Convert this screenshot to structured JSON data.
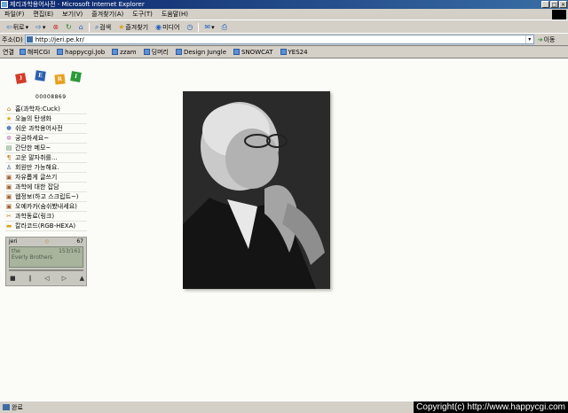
{
  "window": {
    "title": "제리과학용어사전 - Microsoft Internet Explorer"
  },
  "menu": {
    "items": [
      "파일(F)",
      "편집(E)",
      "보기(V)",
      "즐겨찾기(A)",
      "도구(T)",
      "도움말(H)"
    ]
  },
  "toolbar": {
    "back": "뒤로",
    "search": "검색",
    "favorites": "즐겨찾기",
    "media": "미디어"
  },
  "address": {
    "label": "주소(D)",
    "url": "http://jeri.pe.kr/",
    "go": "이동"
  },
  "links": {
    "label": "연결",
    "items": [
      "해피CGI",
      "happycgi.Job",
      "zzam",
      "딩머리",
      "Design Jungle",
      "SNOWCAT",
      "YES24"
    ]
  },
  "site": {
    "logo_letters": [
      "J",
      "E",
      "R",
      "I"
    ],
    "logo_colors": [
      "#d43b2b",
      "#2c5fb0",
      "#e8a020",
      "#2a9a3a"
    ],
    "counter": "00008869",
    "nav": [
      {
        "icon": "home-icon",
        "label": "홈(과학자:Cuck)"
      },
      {
        "icon": "star-icon",
        "label": "오늘의 탄생화"
      },
      {
        "icon": "flower-icon",
        "label": "쉬운 과학용어사전"
      },
      {
        "icon": "sparkle-icon",
        "label": "궁금하세요~"
      },
      {
        "icon": "memo-icon",
        "label": "간단한 메모~"
      },
      {
        "icon": "pin-icon",
        "label": "고운 말자취를..."
      },
      {
        "icon": "user-icon",
        "label": "회원만 가능해요."
      },
      {
        "icon": "board-icon",
        "label": "자유롭게 글쓰기"
      },
      {
        "icon": "board-icon",
        "label": "과학에 대한 잡담"
      },
      {
        "icon": "board-icon",
        "label": "웹정보(하고 스크립트~)"
      },
      {
        "icon": "board-icon",
        "label": "오예카카(숨쉬봤내세요)"
      },
      {
        "icon": "link-icon",
        "label": "과학동료(링크)"
      },
      {
        "icon": "palette-icon",
        "label": "칼라코드(RGB-HEXA)"
      }
    ],
    "player": {
      "name": "jeri",
      "volume": "67",
      "track_label": "the",
      "track_count": "153/161",
      "artist": "Everly Brothers"
    }
  },
  "status": {
    "text": "완료",
    "watermark": "Copyright(c) http://www.happycgi.com"
  }
}
